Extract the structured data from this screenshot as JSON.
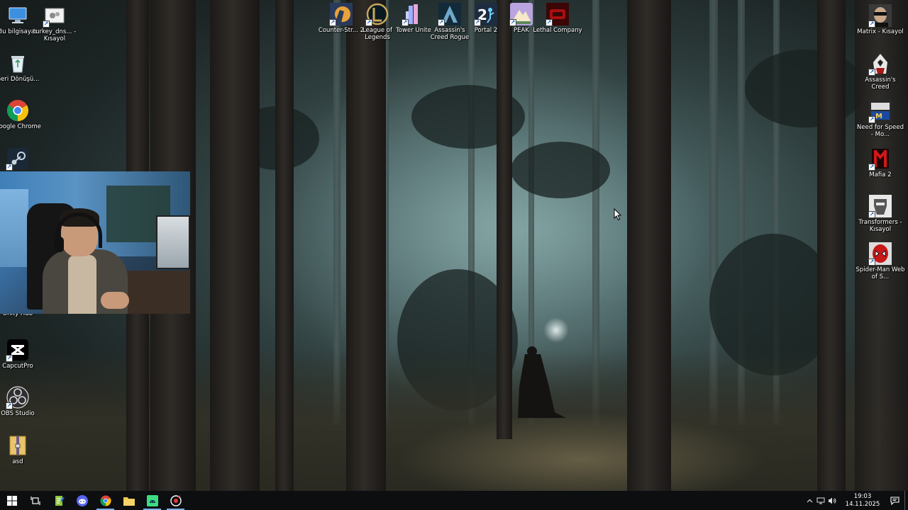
{
  "desktop": {
    "left_icons": [
      {
        "label": "Bu bilgisayar",
        "icon": "this-pc-icon"
      },
      {
        "label": "turkey_dns... - Kısayol",
        "icon": "config-shortcut-icon"
      },
      {
        "label": "Geri Dönüşü...",
        "icon": "recycle-bin-icon"
      },
      {
        "label": "Google Chrome",
        "icon": "chrome-icon"
      },
      {
        "label": "",
        "icon": "steam-icon"
      },
      {
        "label": "Unity Hub",
        "icon": "unity-hub-icon"
      },
      {
        "label": "CapcutPro",
        "icon": "capcut-icon"
      },
      {
        "label": "OBS Studio",
        "icon": "obs-icon"
      },
      {
        "label": "asd",
        "icon": "archive-icon"
      }
    ],
    "top_icons": [
      {
        "label": "Counter-Str... 2",
        "icon": "counter-strike-icon",
        "color": "#e8a33a"
      },
      {
        "label": "League of Legends",
        "icon": "league-of-legends-icon",
        "color": "#c8a85a"
      },
      {
        "label": "Tower Unite",
        "icon": "tower-unite-icon",
        "color": "#8fa2ff"
      },
      {
        "label": "Assassin's Creed Rogue",
        "icon": "ac-rogue-icon",
        "color": "#1b3a4f"
      },
      {
        "label": "Portal 2",
        "icon": "portal-2-icon",
        "color": "#2a3f5c"
      },
      {
        "label": "PEAK",
        "icon": "peak-icon",
        "color": "#b9a4e0"
      },
      {
        "label": "Lethal Company",
        "icon": "lethal-company-icon",
        "color": "#8a0d0d"
      }
    ],
    "right_icons": [
      {
        "label": "Matrix - Kısayol",
        "icon": "matrix-icon"
      },
      {
        "label": "Assassin's Creed",
        "icon": "assassins-creed-icon"
      },
      {
        "label": "Need for Speed - Mo...",
        "icon": "need-for-speed-icon"
      },
      {
        "label": "Mafia 2",
        "icon": "mafia-2-icon"
      },
      {
        "label": "Transformers - Kısayol",
        "icon": "transformers-icon"
      },
      {
        "label": "Spider-Man Web of S...",
        "icon": "spider-man-icon"
      }
    ]
  },
  "taskbar": {
    "apps": [
      {
        "name": "start",
        "icon": "windows-start-icon"
      },
      {
        "name": "task-view",
        "icon": "task-view-icon"
      },
      {
        "name": "notepad-plus",
        "icon": "notepad-icon"
      },
      {
        "name": "discord",
        "icon": "discord-icon"
      },
      {
        "name": "chrome",
        "icon": "chrome-icon"
      },
      {
        "name": "file-explorer",
        "icon": "folder-icon"
      },
      {
        "name": "android-studio",
        "icon": "android-icon"
      },
      {
        "name": "obs-recording",
        "icon": "recording-icon"
      }
    ],
    "clock": {
      "time": "19:03",
      "date": "14.11.2025"
    }
  }
}
